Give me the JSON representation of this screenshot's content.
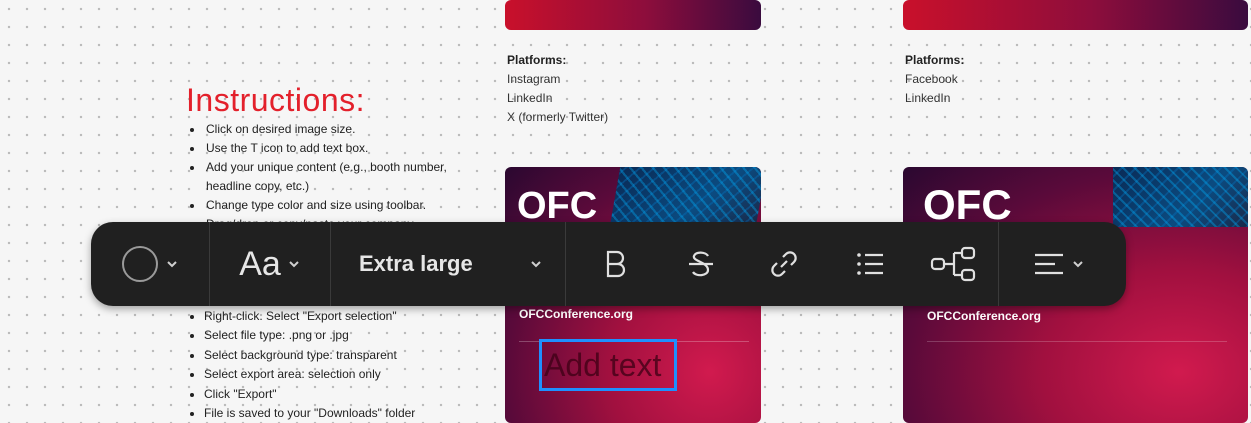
{
  "instructions": {
    "title": "Instructions:",
    "items": [
      "Click on desired image size.",
      "Use the T icon to add text box.",
      "Add your unique content (e.g., booth number, headline copy, etc.)",
      "Change type color and size using toolbar.",
      "Drag/drop or copy/paste your company"
    ],
    "export_items": [
      "Right-click. Select \"Export selection\"",
      "Select file type: .png or .jpg",
      "Select background type: transparent",
      "Select export area: selection only",
      "Click \"Export\"",
      "File is saved to your \"Downloads\" folder"
    ]
  },
  "platforms_left": {
    "heading": "Platforms:",
    "items": [
      "Instagram",
      "LinkedIn",
      "X (formerly Twitter)"
    ]
  },
  "platforms_right": {
    "heading": "Platforms:",
    "items": [
      "Facebook",
      "LinkedIn"
    ]
  },
  "card_left": {
    "logo": "OFC",
    "url": "OFCConference.org",
    "add_text": "Add text"
  },
  "card_right": {
    "logo": "OFC",
    "url": "OFCConference.org"
  },
  "toolbar": {
    "color_icon": "circle-color-icon",
    "font_label": "Aa",
    "size_label": "Extra large",
    "bold_icon": "B",
    "strikethrough_icon": "strikethrough-icon",
    "link_icon": "link-icon",
    "list_icon": "bulleted-list-icon",
    "connector_icon": "connector-icon",
    "align_icon": "align-left-icon"
  },
  "colors": {
    "accent_red": "#e3202b",
    "toolbar_bg": "#202020",
    "selection_blue": "#1e90ff"
  }
}
